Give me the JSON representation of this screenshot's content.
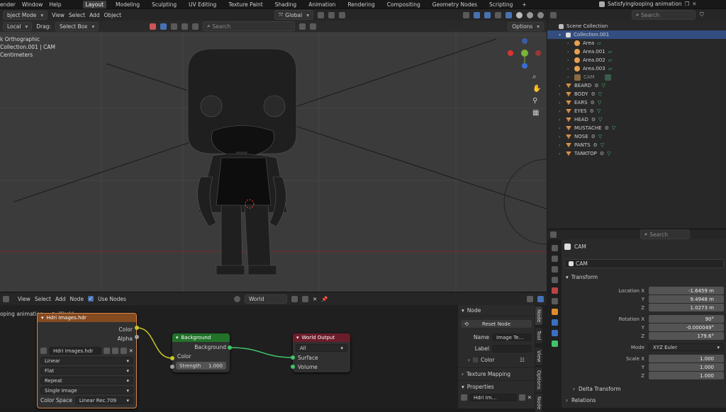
{
  "topbar": {
    "menus": [
      "ender",
      "Window",
      "Help"
    ],
    "workspaces": [
      "Layout",
      "Modeling",
      "Sculpting",
      "UV Editing",
      "Texture Paint",
      "Shading",
      "Animation",
      "Rendering",
      "Compositing",
      "Geometry Nodes",
      "Scripting"
    ],
    "active_workspace": "Layout",
    "add_tab": "+",
    "scene_name": "Satisfyinglooping animation"
  },
  "viewport": {
    "mode": "bject Mode",
    "view": "View",
    "select": "Select",
    "add": "Add",
    "object": "Object",
    "orientation": "Global",
    "transform_space": "Local",
    "drag_label": "Drag:",
    "drag_value": "Select Box",
    "search_placeholder": "Search",
    "options": "Options",
    "overlay_lines": [
      "k Orthographic",
      "Collection.001 | CAM",
      "Centimeters"
    ]
  },
  "outliner": {
    "search_placeholder": "Search",
    "scene_collection": "Scene Collection",
    "collection": "Collection.001",
    "lights": [
      "Area",
      "Area.001",
      "Area.002",
      "Area.003"
    ],
    "camera": "CAM",
    "objects": [
      "BEARD",
      "BODY",
      "EARS",
      "EYES",
      "HEAD",
      "MUSTACHE",
      "NOSE",
      "PANTS",
      "TANKTOP"
    ]
  },
  "properties": {
    "search_placeholder": "Search",
    "object_name": "CAM",
    "object_field": "CAM",
    "transform_title": "Transform",
    "location": {
      "label": "Location X",
      "x": "-1.6459 m",
      "y": "9.4948 m",
      "z": "1.0273 m"
    },
    "rotation": {
      "label": "Rotation X",
      "x": "90°",
      "y": "-0.000049°",
      "z": "179.6°"
    },
    "mode": {
      "label": "Mode",
      "value": "XYZ Euler"
    },
    "scale": {
      "label": "Scale X",
      "x": "1.000",
      "y": "1.000",
      "z": "1.000"
    },
    "axis_y": "Y",
    "axis_z": "Z",
    "delta_transform": "Delta Transform",
    "relations": "Relations"
  },
  "node_editor": {
    "menus": [
      "View",
      "Select",
      "Add",
      "Node"
    ],
    "use_nodes": "Use Nodes",
    "world_name": "World",
    "breadcrumb_left": "oping animation",
    "breadcrumb_right": "World",
    "image_node": {
      "title": "Hdri Images.hdr",
      "out_color": "Color",
      "out_alpha": "Alpha",
      "image": "Hdri Images.hdr",
      "interp": "Linear",
      "proj": "Flat",
      "ext": "Repeat",
      "source": "Single Image",
      "cs_label": "Color Space",
      "cs_value": "Linear Rec.709"
    },
    "bg_node": {
      "title": "Background",
      "out": "Background",
      "in_color": "Color",
      "strength_label": "Strength",
      "strength": "1.000"
    },
    "out_node": {
      "title": "World Output",
      "target": "All",
      "surface": "Surface",
      "volume": "Volume"
    }
  },
  "npanel": {
    "node_title": "Node",
    "reset": "Reset Node",
    "name_label": "Name",
    "name_value": "Image Te...",
    "label_label": "Label",
    "color": "Color",
    "texture_mapping": "Texture Mapping",
    "properties": "Properties",
    "img": "Hdri Im...",
    "tabs": [
      "Node",
      "Tool",
      "View",
      "Options",
      "Node"
    ]
  },
  "colors": {
    "accent": "#4772b3",
    "selected": "#334d80",
    "image_header": "#844a20",
    "shader_header": "#22722a",
    "output_header": "#6b1c2a",
    "link_color": "#43c36b",
    "color_socket": "#c7c729"
  }
}
